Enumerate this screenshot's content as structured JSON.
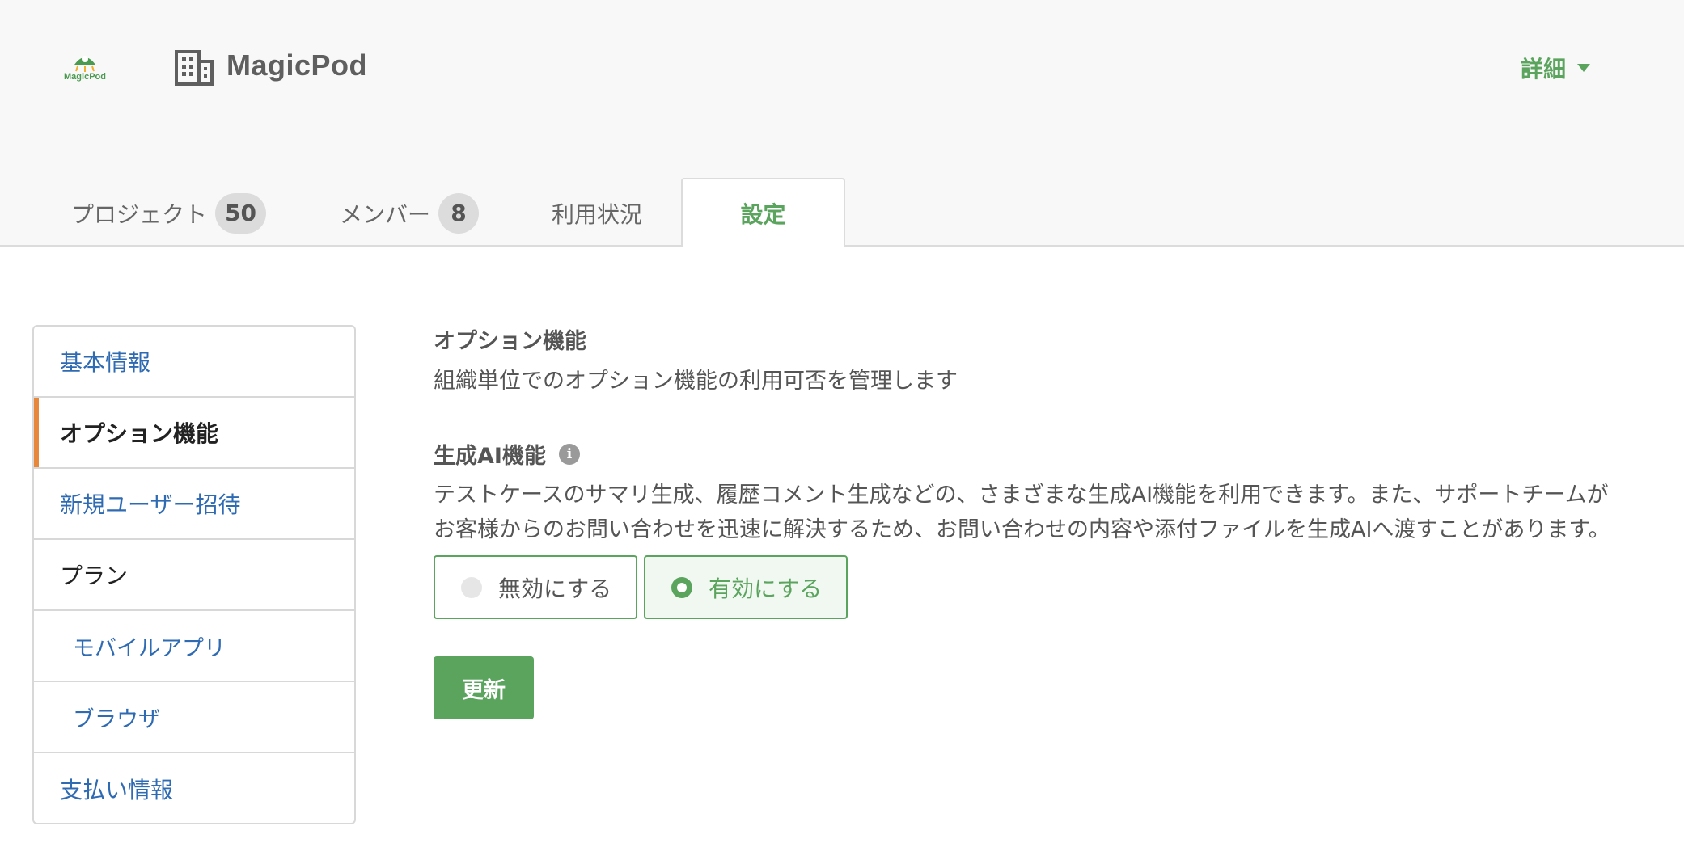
{
  "header": {
    "logo_text": "MagicPod",
    "org_name": "MagicPod",
    "details_label": "詳細",
    "logo_icon": "magicpod-logo-icon",
    "org_icon": "building-icon"
  },
  "tabs": [
    {
      "label": "プロジェクト",
      "count": "50"
    },
    {
      "label": "メンバー",
      "count": "8"
    },
    {
      "label": "利用状況"
    },
    {
      "label": "設定",
      "active": true
    }
  ],
  "sidebar": {
    "items": [
      {
        "label": "基本情報"
      },
      {
        "label": "オプション機能",
        "active": true
      },
      {
        "label": "新規ユーザー招待"
      },
      {
        "label": "プラン"
      },
      {
        "label": "モバイルアプリ"
      },
      {
        "label": "ブラウザ"
      },
      {
        "label": "支払い情報"
      }
    ]
  },
  "main": {
    "section_title": "オプション機能",
    "section_desc": "組織単位でのオプション機能の利用可否を管理します",
    "feature": {
      "title": "生成AI機能",
      "info_icon": "i",
      "desc": "テストケースのサマリ生成、履歴コメント生成などの、さまざまな生成AI機能を利用できます。また、サポートチームがお客様からのお問い合わせを迅速に解決するため、お問い合わせの内容や添付ファイルを生成AIへ渡すことがあります。",
      "options": [
        {
          "label": "無効にする",
          "checked": false
        },
        {
          "label": "有効にする",
          "checked": true
        }
      ]
    },
    "update_label": "更新"
  },
  "colors": {
    "accent_green": "#5aa45e",
    "link_blue": "#2f6bb3",
    "active_marker": "#e8873a"
  }
}
